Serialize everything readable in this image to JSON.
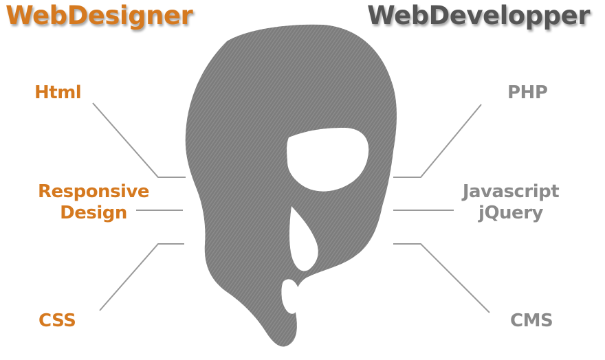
{
  "colors": {
    "designer": "#d5791f",
    "developer": "#555555",
    "developer_skill": "#8a8a8a",
    "head": "#7a7a7a",
    "lines": "#9a9a9a"
  },
  "designer": {
    "title": "WebDesigner",
    "skills": {
      "html": "Html",
      "responsive_line1": "Responsive",
      "responsive_line2": "Design",
      "css": "CSS"
    }
  },
  "developer": {
    "title": "WebDevelopper",
    "skills": {
      "php": "PHP",
      "js_line1": "Javascript",
      "js_line2": "jQuery",
      "cms": "CMS"
    }
  }
}
